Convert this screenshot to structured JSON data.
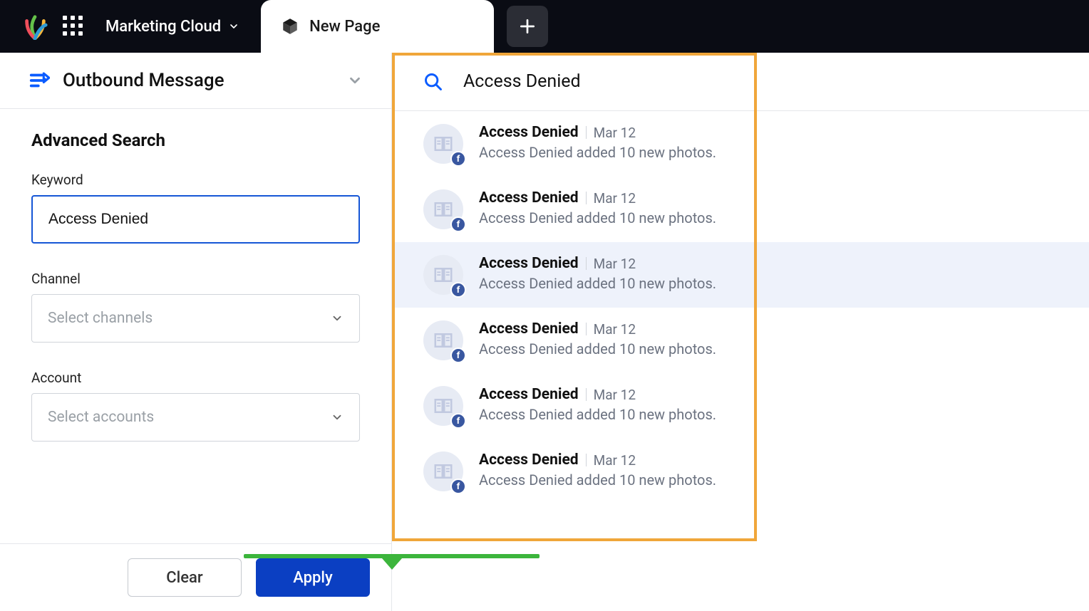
{
  "header": {
    "module_name": "Marketing Cloud",
    "tab_label": "New Page"
  },
  "left_panel": {
    "entity_title": "Outbound Message",
    "advanced_search_title": "Advanced Search",
    "keyword_label": "Keyword",
    "keyword_value": "Access Denied",
    "channel_label": "Channel",
    "channel_placeholder": "Select channels",
    "account_label": "Account",
    "account_placeholder": "Select accounts",
    "clear_label": "Clear",
    "apply_label": "Apply"
  },
  "right_panel": {
    "search_text": "Access Denied",
    "results": [
      {
        "title": "Access Denied",
        "date": "Mar 12",
        "desc": "Access Denied added 10 new photos.",
        "highlight": false
      },
      {
        "title": "Access Denied",
        "date": "Mar 12",
        "desc": "Access Denied added 10 new photos.",
        "highlight": false
      },
      {
        "title": "Access Denied",
        "date": "Mar 12",
        "desc": "Access Denied added 10 new photos.",
        "highlight": true
      },
      {
        "title": "Access Denied",
        "date": "Mar 12",
        "desc": "Access Denied added 10 new photos.",
        "highlight": false
      },
      {
        "title": "Access Denied",
        "date": "Mar 12",
        "desc": "Access Denied added 10 new photos.",
        "highlight": false
      },
      {
        "title": "Access Denied",
        "date": "Mar 12",
        "desc": "Access Denied added 10 new photos.",
        "highlight": false
      }
    ]
  }
}
